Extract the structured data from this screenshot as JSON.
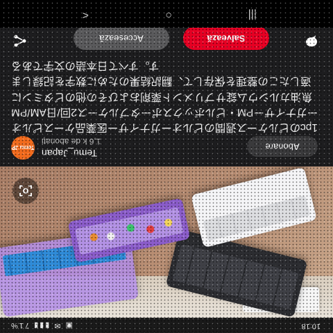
{
  "status_bar": {
    "time": "10:18",
    "icons": "▣ ✉ ▮▮▮ 71%"
  },
  "pin": {
    "account_name": "Temu_Japan",
    "account_subscribers": "1,6 k de abonați",
    "avatar_text": "Temu JP",
    "subscribe_label": "Abonare",
    "description": "1pcのピルケース週間のピルオーガナイザー医薬品ケースピルオーガナイザーPM・ピルボックスポータブルケース2回/日AM/PM魚油カルシウム錠サプリメント薬剤およびその他のビタミンに適したこの整理を保存して、翻訳結果のために数字を記録します。すべて日本語の文字である"
  },
  "actions": {
    "visit_label": "Accesează",
    "save_label": "Salvează",
    "save_color": "#e60023",
    "share_icon": "share-icon",
    "comment_icon": "comment-icon"
  },
  "lens_icon": "visual-search-icon",
  "nav": {
    "recent": "|||",
    "home": "○",
    "back": "<"
  }
}
